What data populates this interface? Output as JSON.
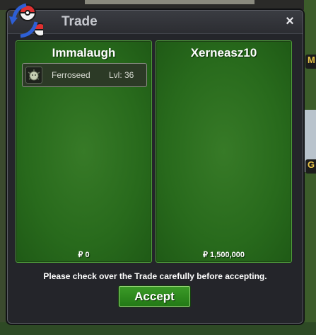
{
  "dialog": {
    "title": "Trade",
    "close_label": "×"
  },
  "left_panel": {
    "trainer": "Immalaugh",
    "money": "₽ 0",
    "pokemon": [
      {
        "name": "Ferroseed",
        "level": "Lvl: 36",
        "icon": "ferroseed-icon"
      }
    ]
  },
  "right_panel": {
    "trainer": "Xerneasz10",
    "money": "₽ 1,500,000"
  },
  "notice": "Please check over the Trade carefully before accepting.",
  "accept_label": "Accept",
  "background_chips": [
    "M",
    "G"
  ],
  "colors": {
    "panel_green": "#2d6e20",
    "accept_green": "#2f8c20",
    "dialog_bg": "#24252a"
  }
}
